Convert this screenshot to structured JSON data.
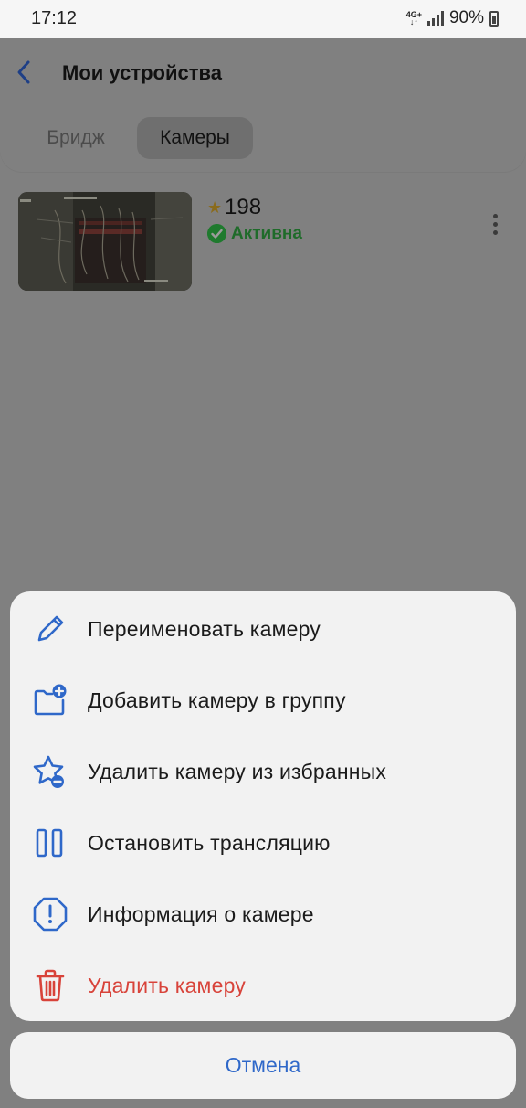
{
  "statusbar": {
    "time": "17:12",
    "network_top": "4G+",
    "network_bottom": "↓↑",
    "battery": "90%"
  },
  "header": {
    "title": "Мои устройства"
  },
  "tabs": [
    {
      "label": "Бридж",
      "selected": false
    },
    {
      "label": "Камеры",
      "selected": true
    }
  ],
  "camera": {
    "name": "198",
    "status": "Активна",
    "favorite": true
  },
  "menu": {
    "items": [
      {
        "label": "Переименовать камеру",
        "icon": "pencil-icon"
      },
      {
        "label": "Добавить камеру в группу",
        "icon": "folder-plus-icon"
      },
      {
        "label": "Удалить камеру из избранных",
        "icon": "star-minus-icon"
      },
      {
        "label": "Остановить трансляцию",
        "icon": "pause-icon"
      },
      {
        "label": "Информация о камере",
        "icon": "info-icon"
      },
      {
        "label": "Удалить камеру",
        "icon": "trash-icon",
        "danger": true
      }
    ],
    "cancel_label": "Отмена"
  },
  "colors": {
    "accent": "#2f68c9",
    "danger": "#d8433a",
    "active": "#1f7a2e",
    "scrim": "#808080",
    "sheet": "#f2f2f2"
  }
}
